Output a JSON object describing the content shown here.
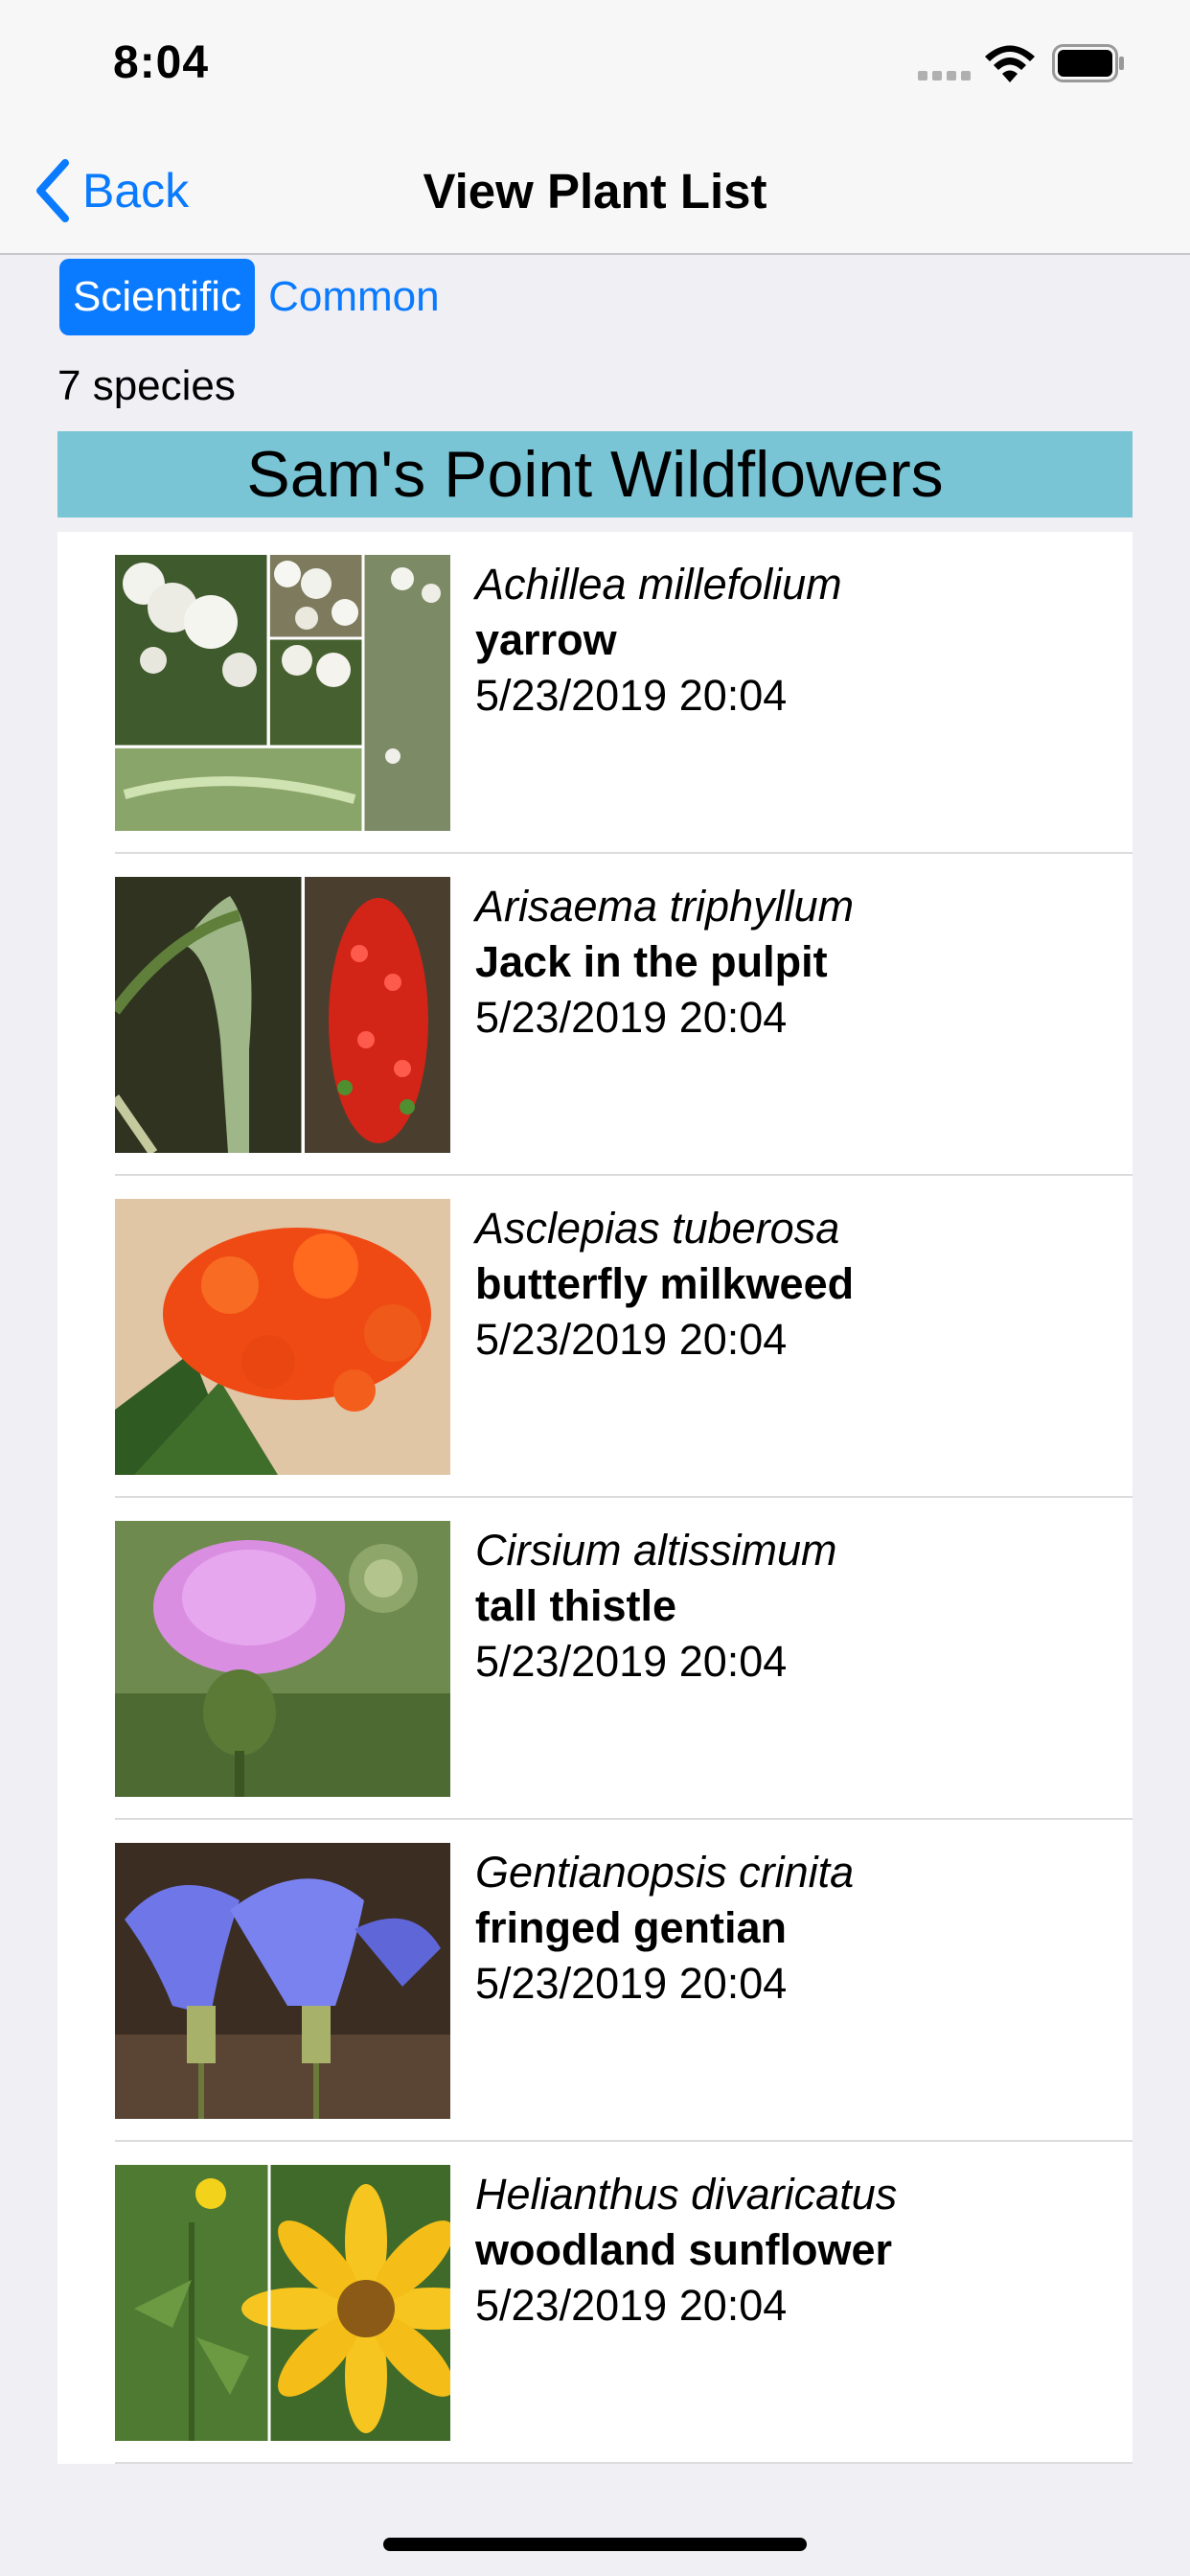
{
  "status": {
    "time": "8:04"
  },
  "nav": {
    "back_label": "Back",
    "title": "View Plant List"
  },
  "segment": {
    "scientific": "Scientific",
    "common": "Common",
    "selected": "Scientific"
  },
  "species_count": "7 species",
  "list_title": "Sam's Point Wildflowers",
  "plants": [
    {
      "scientific": "Achillea millefolium",
      "common": "yarrow",
      "date": "5/23/2019 20:04"
    },
    {
      "scientific": "Arisaema triphyllum",
      "common": "Jack in the pulpit",
      "date": "5/23/2019 20:04"
    },
    {
      "scientific": "Asclepias tuberosa",
      "common": "butterfly milkweed",
      "date": "5/23/2019 20:04"
    },
    {
      "scientific": "Cirsium altissimum",
      "common": "tall thistle",
      "date": "5/23/2019 20:04"
    },
    {
      "scientific": "Gentianopsis crinita",
      "common": "fringed gentian",
      "date": "5/23/2019 20:04"
    },
    {
      "scientific": "Helianthus divaricatus",
      "common": "woodland sunflower",
      "date": "5/23/2019 20:04"
    }
  ],
  "colors": {
    "accent": "#0a7aff",
    "header_bg": "#79c5d6",
    "background": "#efeff4"
  }
}
